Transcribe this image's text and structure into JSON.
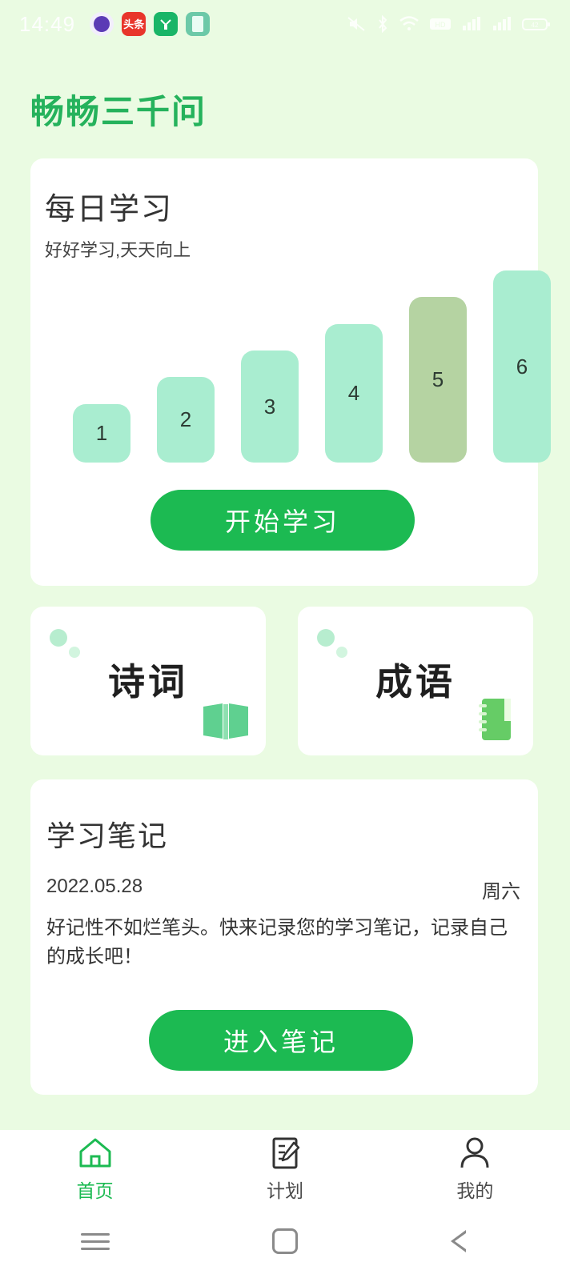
{
  "status_bar": {
    "time": "14:49",
    "app_icons": [
      {
        "name": "notification-app-purple",
        "label": ""
      },
      {
        "name": "notification-app-toutiao",
        "label": "头条"
      },
      {
        "name": "notification-app-shopping",
        "label": ""
      },
      {
        "name": "notification-app-book",
        "label": ""
      }
    ],
    "system_icons": [
      "vibrate-icon",
      "bluetooth-icon",
      "wifi-icon",
      "hd-icon",
      "signal-one-icon",
      "signal-two-icon",
      "battery-icon"
    ]
  },
  "app": {
    "title": "畅畅三千问",
    "title_color": "#25b25c",
    "background_color": "#eafbe2"
  },
  "daily": {
    "title": "每日学习",
    "subtitle": "好好学习,天天向上",
    "start_button": "开始学习"
  },
  "chart_data": {
    "type": "bar",
    "title": "每日学习",
    "categories": [
      "1",
      "2",
      "3",
      "4",
      "5",
      "6"
    ],
    "values": [
      1,
      2,
      3,
      4,
      5,
      6
    ],
    "bar_labels": [
      "1",
      "2",
      "3",
      "4",
      "5",
      "6"
    ],
    "bar_colors": [
      "#a9edd0",
      "#a9edd0",
      "#a9edd0",
      "#a9edd0",
      "#b5d3a2",
      "#a9edd0"
    ],
    "highlight_index": 4,
    "xlabel": "",
    "ylabel": "",
    "ylim": [
      0,
      6
    ],
    "grid": false,
    "legend": "none"
  },
  "categories": [
    {
      "title": "诗词",
      "icon": "open-book-icon",
      "icon_color": "#5fd090"
    },
    {
      "title": "成语",
      "icon": "notebook-icon",
      "icon_color": "#66cc66"
    }
  ],
  "notes": {
    "title": "学习笔记",
    "date": "2022.05.28",
    "weekday": "周六",
    "description": "好记性不如烂笔头。快来记录您的学习笔记，记录自己的成长吧！",
    "enter_button": "进入笔记"
  },
  "tabbar": {
    "items": [
      {
        "label": "首页",
        "icon": "home-icon",
        "active": true
      },
      {
        "label": "计划",
        "icon": "note-pencil-icon",
        "active": false
      },
      {
        "label": "我的",
        "icon": "person-icon",
        "active": false
      }
    ],
    "active_color": "#1cba52",
    "inactive_color": "#4a4a4a"
  },
  "android_nav": {
    "items": [
      {
        "name": "recents-button",
        "icon": "hamburger-icon"
      },
      {
        "name": "home-button",
        "icon": "square-icon"
      },
      {
        "name": "back-button",
        "icon": "triangle-left-icon"
      }
    ]
  }
}
